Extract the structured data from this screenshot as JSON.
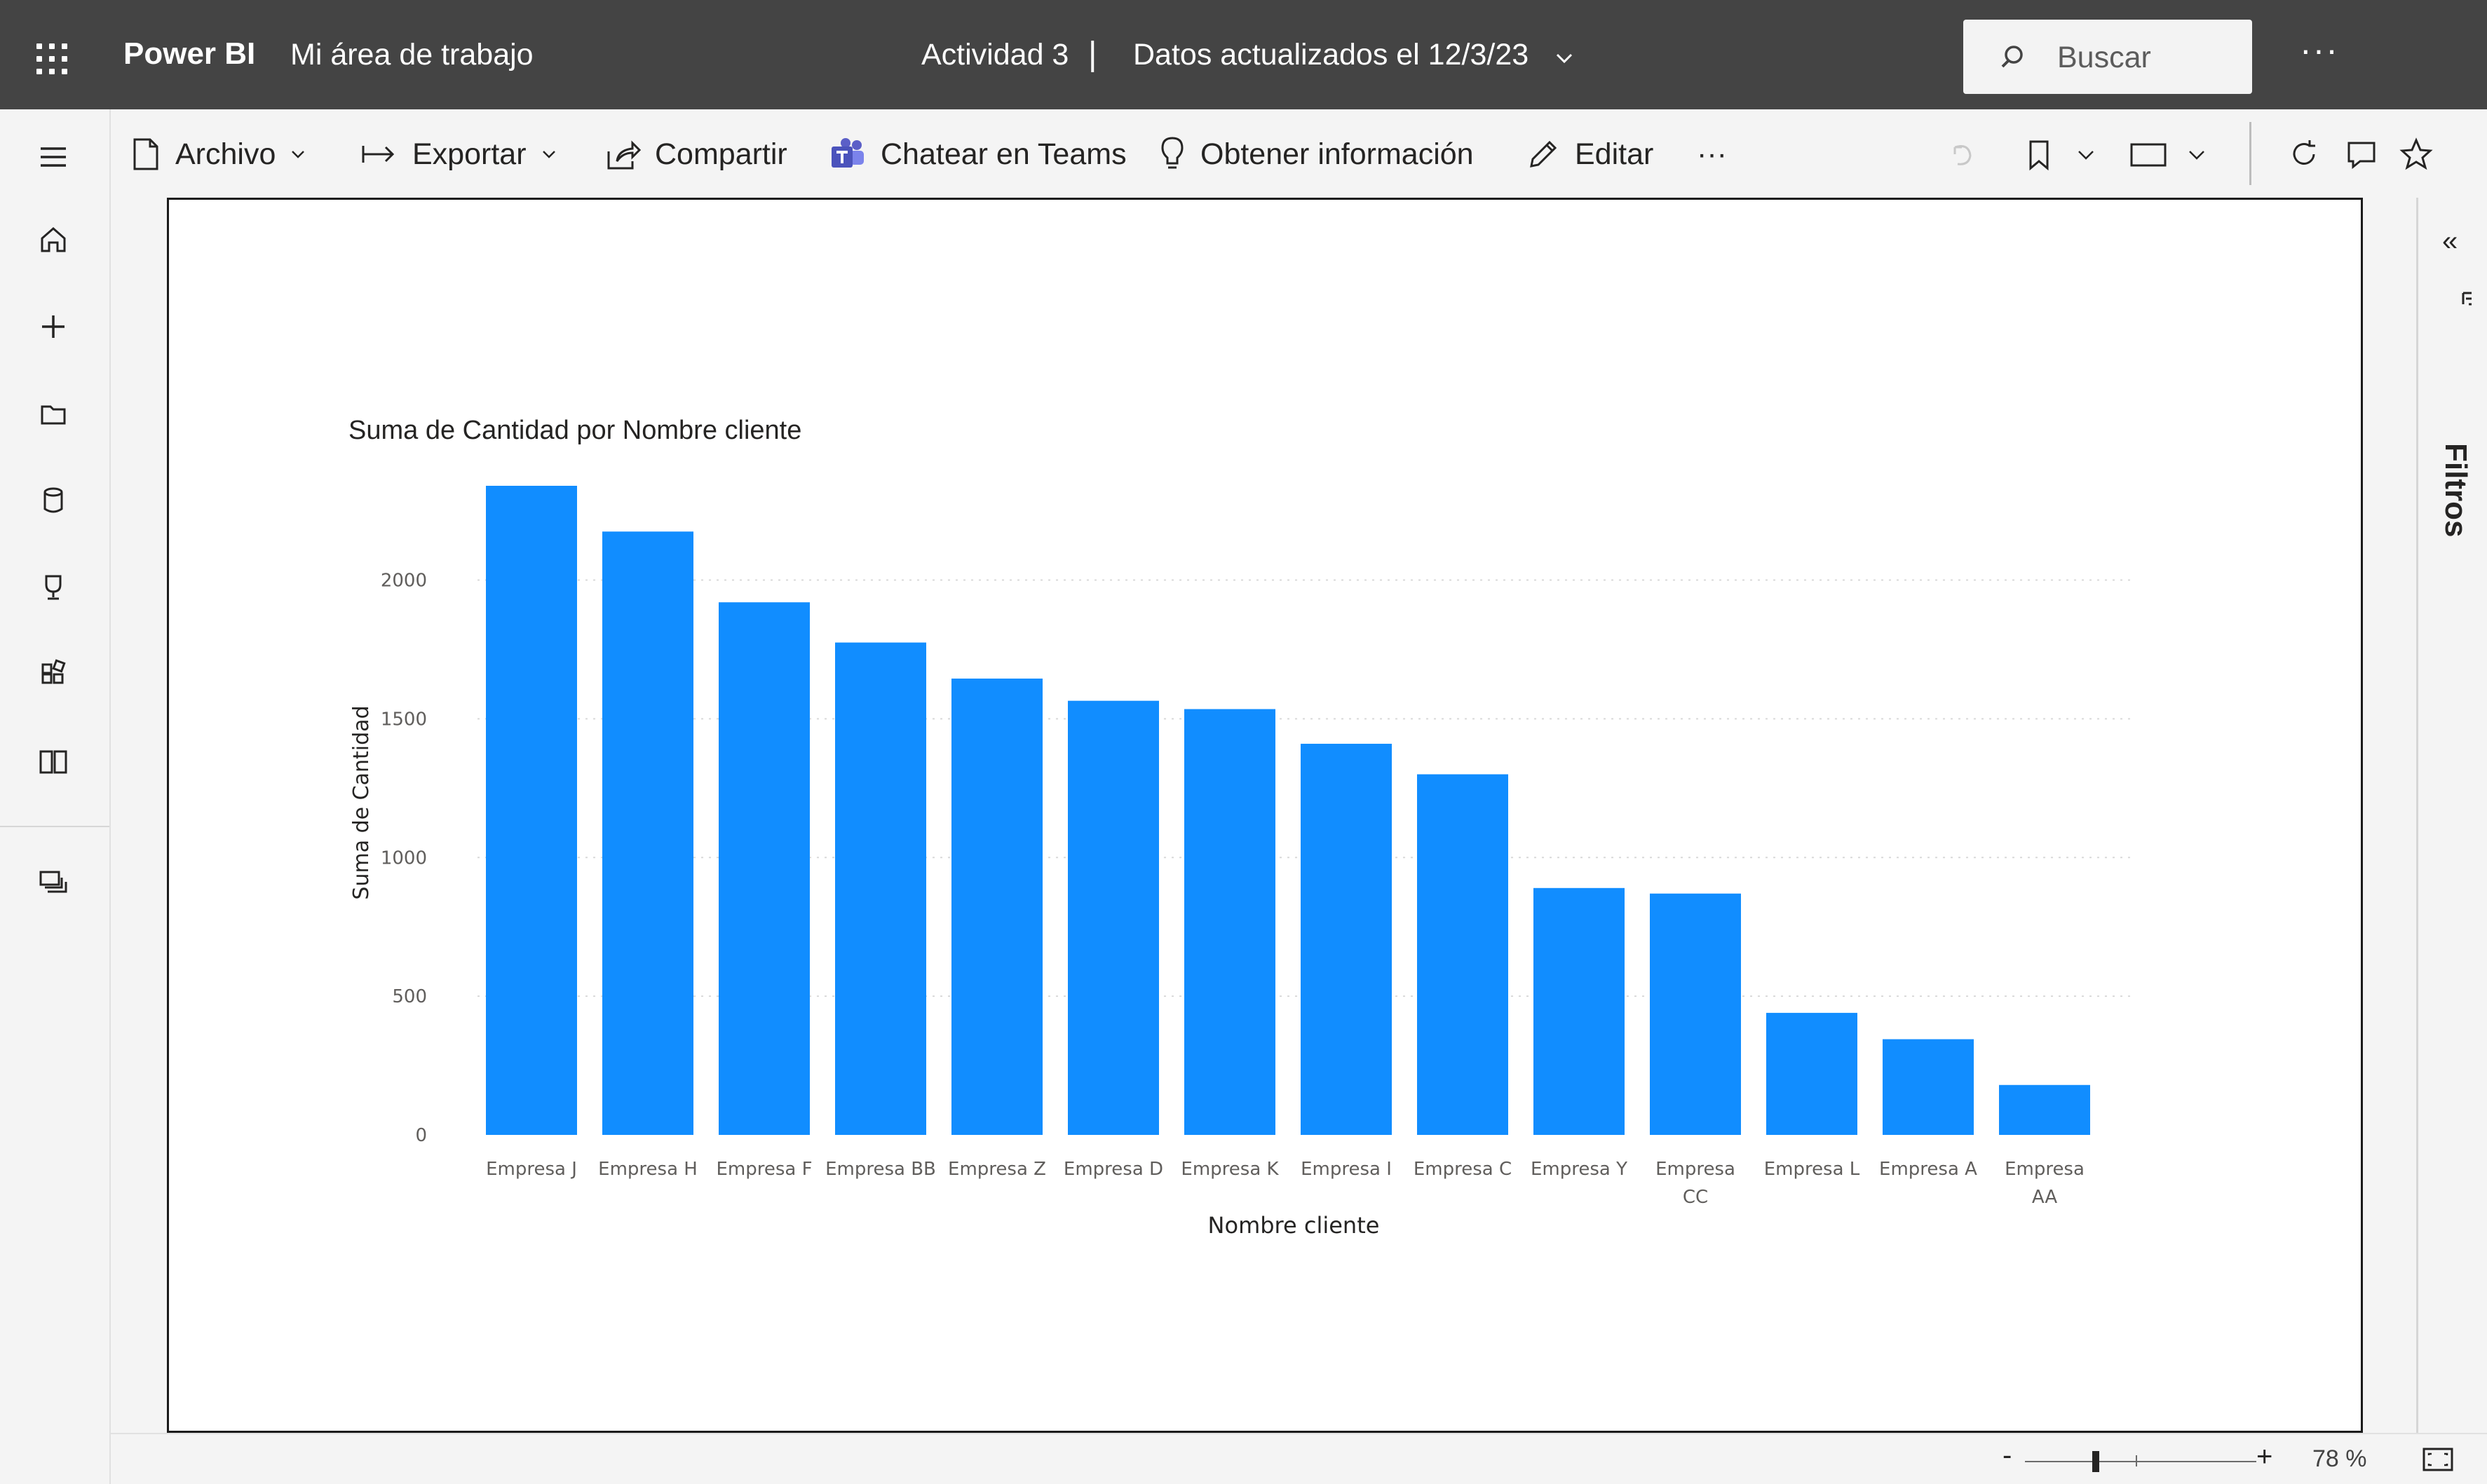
{
  "topbar": {
    "brand": "Power BI",
    "workspace": "Mi área de trabajo",
    "report_name": "Actividad 3",
    "separator": "|",
    "data_updated": "Datos actualizados el 12/3/23",
    "search_placeholder": "Buscar",
    "more": "···"
  },
  "toolbar": {
    "file": "Archivo",
    "export": "Exportar",
    "share": "Compartir",
    "teams": "Chatear en Teams",
    "insights": "Obtener información",
    "edit": "Editar",
    "more": "···"
  },
  "filters": {
    "collapse": "«",
    "label": "Filtros"
  },
  "statusbar": {
    "zoom_minus": "-",
    "zoom_plus": "+",
    "zoom_value": "78 %",
    "zoom_level": 0.78
  },
  "icons": [
    "waffle-icon",
    "search-icon",
    "hamburger-icon",
    "home-icon",
    "create-icon",
    "browse-icon",
    "data-hub-icon",
    "goals-icon",
    "apps-icon",
    "learn-icon",
    "workspaces-icon",
    "file-icon",
    "export-icon",
    "share-icon",
    "teams-icon",
    "lightbulb-icon",
    "pencil-icon",
    "undo-icon",
    "bookmark-icon",
    "view-icon",
    "refresh-icon",
    "comment-icon",
    "favorite-icon",
    "filter-icon",
    "fit-page-icon"
  ],
  "colors": {
    "topbar": "#444444",
    "bar": "#118DFF",
    "background": "#f4f4f4"
  },
  "chart_data": {
    "type": "bar",
    "title": "Suma de Cantidad por Nombre cliente",
    "xlabel": "Nombre cliente",
    "ylabel": "Suma de Cantidad",
    "categories": [
      [
        "Empresa J"
      ],
      [
        "Empresa H"
      ],
      [
        "Empresa F"
      ],
      [
        "Empresa BB"
      ],
      [
        "Empresa Z"
      ],
      [
        "Empresa D"
      ],
      [
        "Empresa K"
      ],
      [
        "Empresa I"
      ],
      [
        "Empresa C"
      ],
      [
        "Empresa Y"
      ],
      [
        "Empresa",
        "CC"
      ],
      [
        "Empresa L"
      ],
      [
        "Empresa A"
      ],
      [
        "Empresa",
        "AA"
      ]
    ],
    "values": [
      2340,
      2175,
      1920,
      1775,
      1645,
      1565,
      1535,
      1410,
      1300,
      890,
      870,
      440,
      345,
      180
    ],
    "yticks": [
      0,
      500,
      1000,
      1500,
      2000
    ],
    "ylim": [
      0,
      2340
    ],
    "grid": true,
    "color": "#118DFF"
  }
}
